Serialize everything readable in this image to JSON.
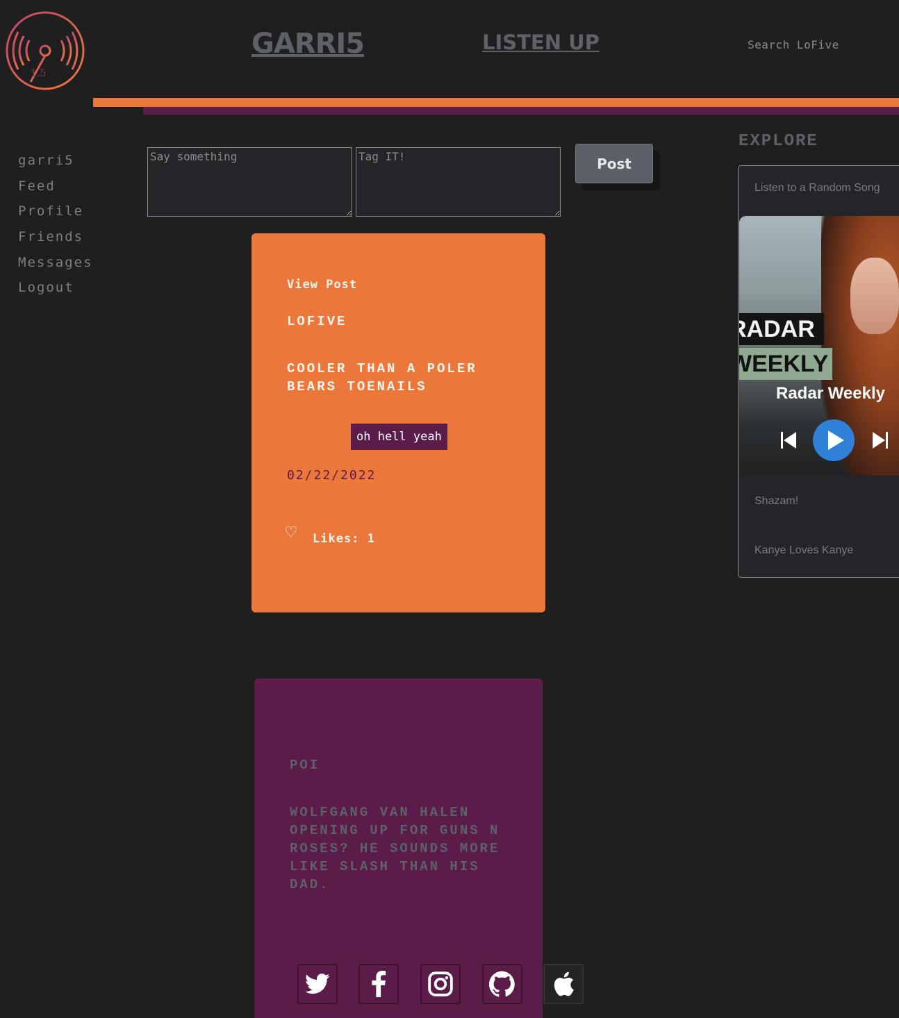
{
  "header": {
    "brand": "GARRI5",
    "listen_link": "LISTEN UP",
    "search_placeholder": "Search LoFive"
  },
  "sidebar": {
    "items": [
      {
        "label": "garri5"
      },
      {
        "label": "Feed"
      },
      {
        "label": "Profile"
      },
      {
        "label": "Friends"
      },
      {
        "label": "Messages"
      },
      {
        "label": "Logout"
      }
    ]
  },
  "composer": {
    "message_placeholder": "Say something",
    "tag_placeholder": "Tag IT!",
    "post_label": "Post"
  },
  "posts": [
    {
      "view_label": "View Post",
      "username": "LOFIVE",
      "body": "COOLER THAN A POLER BEARS TOENAILS",
      "tag": "oh hell yeah",
      "date": "02/22/2022",
      "likes_label": "Likes: 1",
      "heart": "♡"
    },
    {
      "username": "POI",
      "body": "WOLFGANG VAN HALEN OPENING UP FOR GUNS N ROSES? HE SOUNDS MORE LIKE SLASH THAN HIS DAD."
    }
  ],
  "explore": {
    "title": "EXPLORE",
    "random_song": "Listen to a Random Song",
    "player": {
      "cover_line1": "RADAR",
      "cover_line2": "WEEKLY",
      "title": "Radar Weekly"
    },
    "shazam": "Shazam!",
    "kanye": "Kanye Loves Kanye"
  },
  "social": [
    "twitter-icon",
    "facebook-icon",
    "instagram-icon",
    "github-icon",
    "apple-icon"
  ],
  "colors": {
    "background": "#1f1f1f",
    "orange": "#ec773b",
    "purple": "#5b1c4a",
    "muted": "#5d6168"
  }
}
